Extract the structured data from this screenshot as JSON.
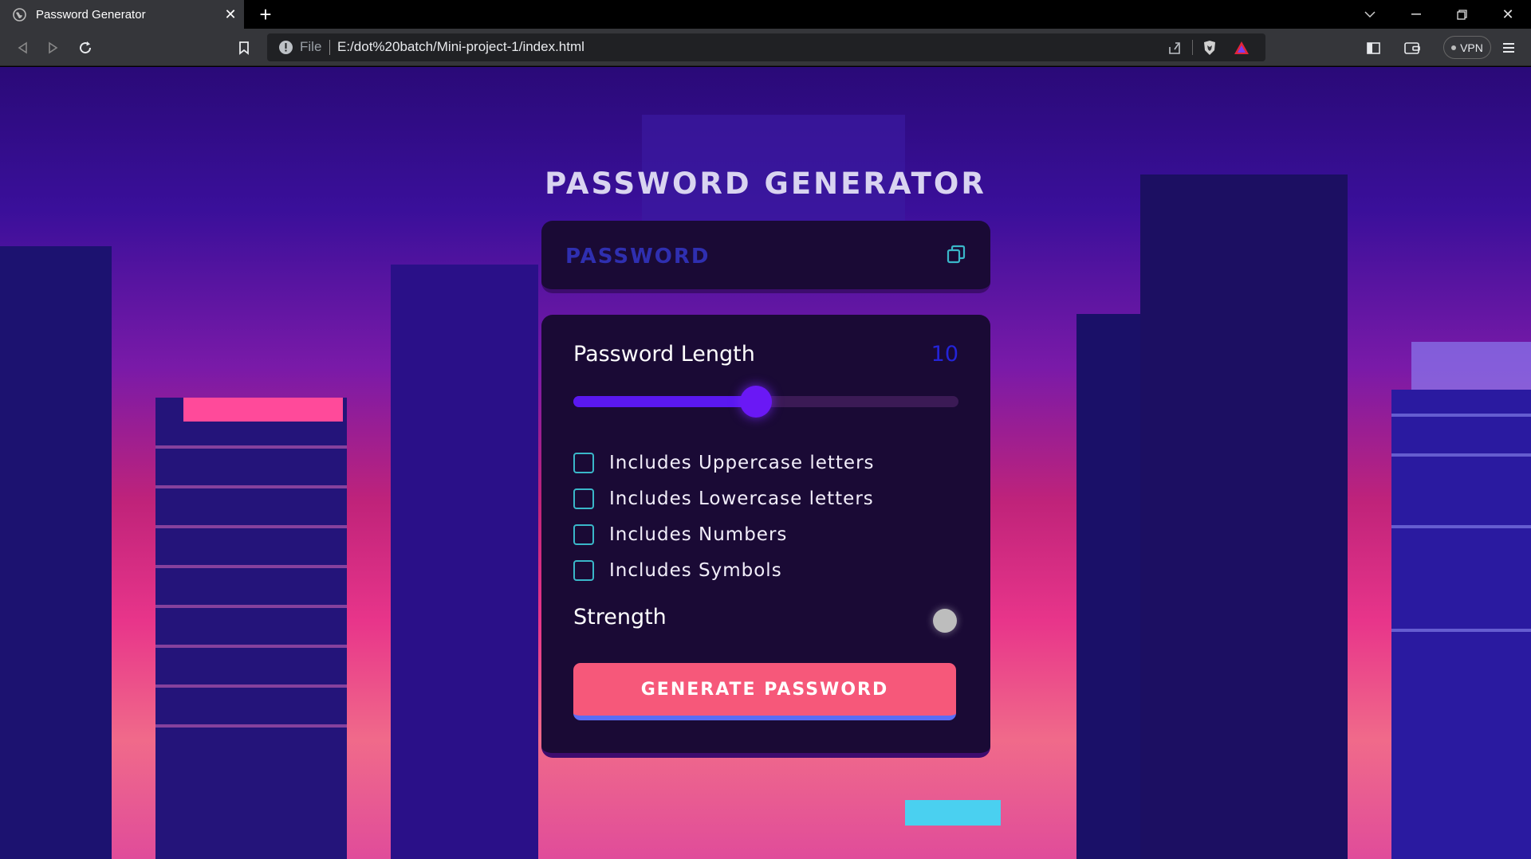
{
  "browser": {
    "tab_title": "Password Generator",
    "address_scheme": "File",
    "address_url": "E:/dot%20batch/Mini-project-1/index.html",
    "vpn_label": "VPN"
  },
  "app": {
    "title": "PASSWORD GENERATOR",
    "password_placeholder": "PASSWORD",
    "length_label": "Password Length",
    "length_value": "10",
    "slider_fraction": 0.475,
    "options": [
      {
        "label": "Includes Uppercase letters",
        "checked": false
      },
      {
        "label": "Includes Lowercase letters",
        "checked": false
      },
      {
        "label": "Includes Numbers",
        "checked": false
      },
      {
        "label": "Includes Symbols",
        "checked": false
      }
    ],
    "strength_label": "Strength",
    "strength_color": "#bdbdbd",
    "generate_label": "GENERATE PASSWORD"
  },
  "colors": {
    "panel": "#1a0a35",
    "accent": "#5a18f0",
    "checkbox_border": "#3ab7c9",
    "button": "#f6587a"
  }
}
